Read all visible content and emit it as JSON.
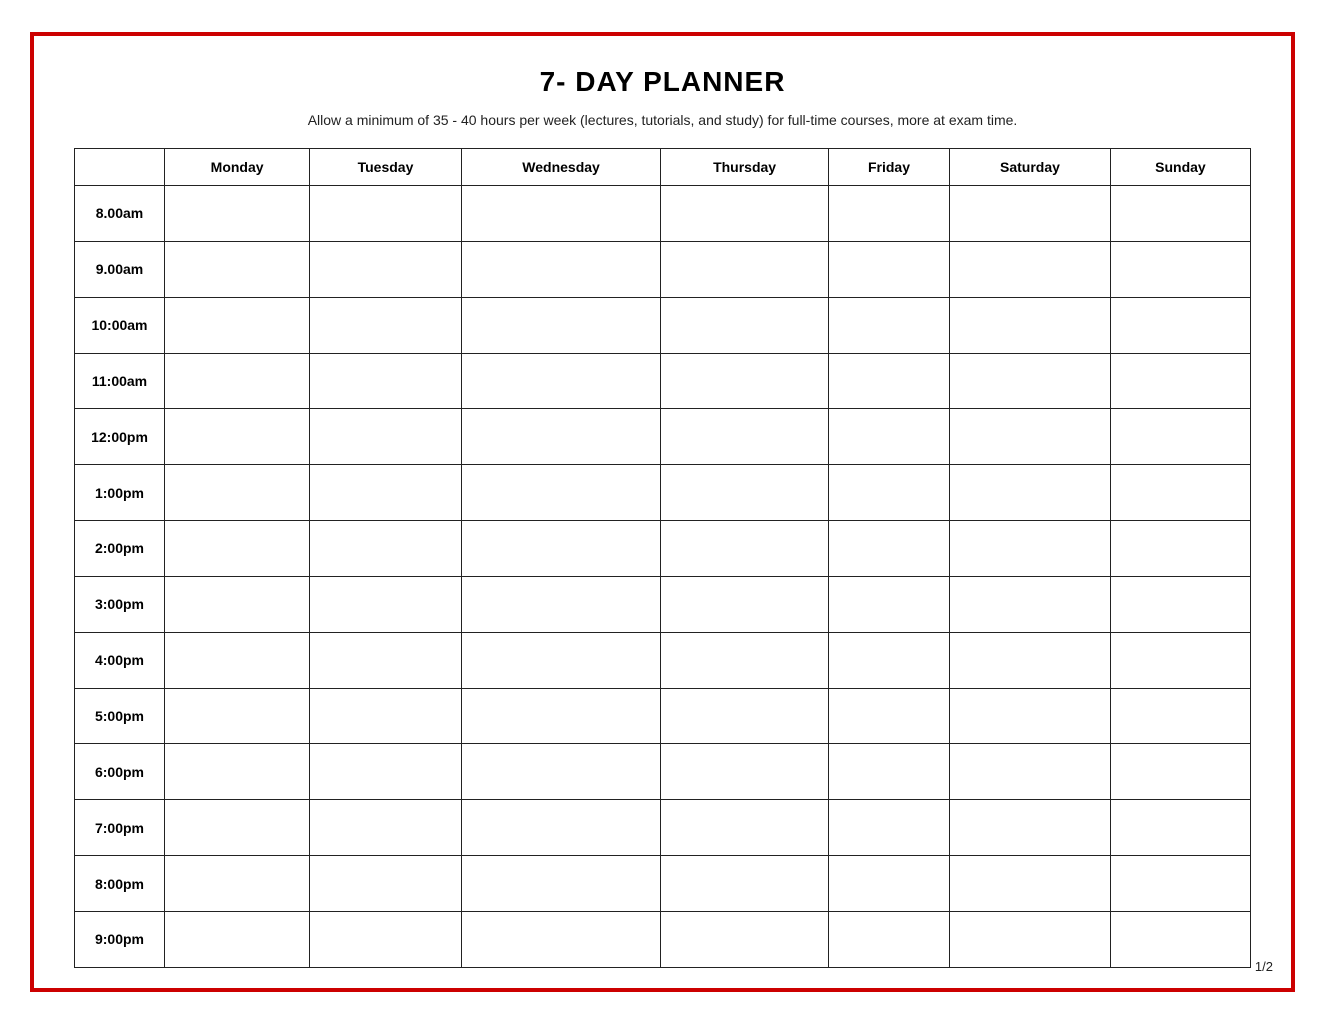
{
  "page": {
    "title": "7- DAY PLANNER",
    "subtitle": "Allow a minimum of 35 - 40 hours per week (lectures, tutorials, and study) for full-time courses, more at exam time.",
    "page_number": "1/2"
  },
  "table": {
    "headers": [
      "",
      "Monday",
      "Tuesday",
      "Wednesday",
      "Thursday",
      "Friday",
      "Saturday",
      "Sunday"
    ],
    "time_slots": [
      "8.00am",
      "9.00am",
      "10:00am",
      "11:00am",
      "12:00pm",
      "1:00pm",
      "2:00pm",
      "3:00pm",
      "4:00pm",
      "5:00pm",
      "6:00pm",
      "7:00pm",
      "8:00pm",
      "9:00pm"
    ]
  }
}
